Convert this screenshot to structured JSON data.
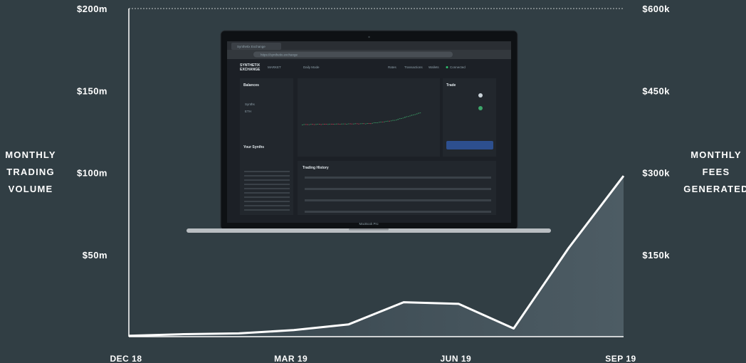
{
  "chart_data": {
    "type": "line",
    "categories": [
      "DEC 18",
      "MAR 19",
      "JUN 19",
      "SEP 19"
    ],
    "ylabel_left": [
      "MONTHLY",
      "TRADING",
      "VOLUME"
    ],
    "ylabel_right": [
      "MONTHLY",
      "FEES",
      "GENERATED"
    ],
    "ylim_left": [
      0,
      200
    ],
    "ylim_right": [
      0,
      600
    ],
    "left_ticks": [
      {
        "value": 200,
        "label": "$200m"
      },
      {
        "value": 150,
        "label": "$150m"
      },
      {
        "value": 100,
        "label": "$100m"
      },
      {
        "value": 50,
        "label": "$50m"
      }
    ],
    "right_ticks": [
      {
        "value": 600,
        "label": "$600k"
      },
      {
        "value": 450,
        "label": "$450k"
      },
      {
        "value": 300,
        "label": "$300k"
      },
      {
        "value": 150,
        "label": "$150k"
      }
    ],
    "series": [
      {
        "x": [
          0,
          1,
          2,
          3,
          4,
          5,
          6,
          7,
          8,
          9
        ],
        "values": [
          0.5,
          1.5,
          2.0,
          4.0,
          7.5,
          21.0,
          20.0,
          5.0,
          54.0,
          98.0
        ]
      }
    ],
    "colors": {
      "background": "#313e44",
      "line": "#ffffff",
      "fill": "#4a5961"
    }
  },
  "laptop": {
    "tab_title": "Synthetix Exchange",
    "url": "https://synthetix.exchange",
    "brand_line1": "SYNTHETIX",
    "brand_line2": "EXCHANGE",
    "nav_market": "MARKET",
    "nav_daily": "Daily Mode",
    "nav_rates": "Rates",
    "nav_transactions": "Transactions",
    "nav_wallets": "Wallets",
    "status": "Connected",
    "balances_title": "Balances",
    "your_synths": "Your Synths",
    "trade_title": "Trade",
    "trading_history": "Trading History",
    "synths_label": "Synths",
    "eth_label": "ETH",
    "brand_label": "MacBook Pro"
  }
}
